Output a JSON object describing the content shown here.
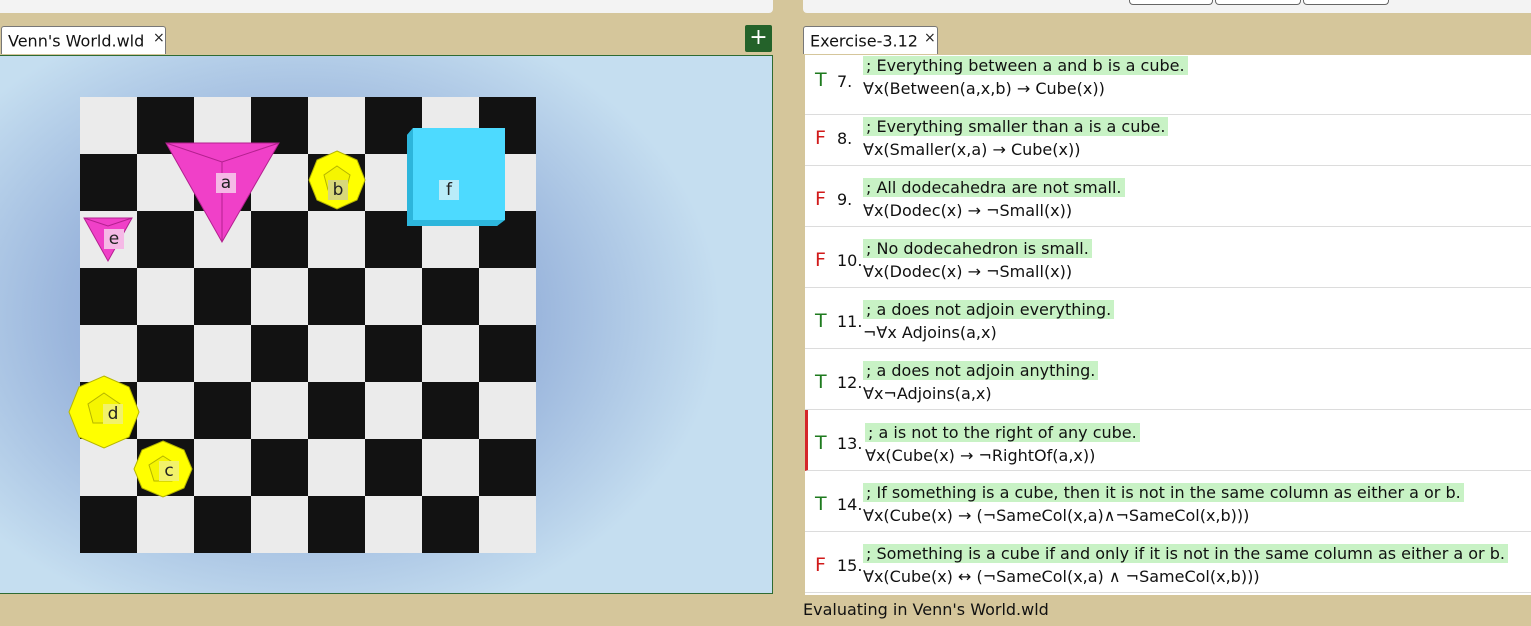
{
  "world_tab": {
    "label": "Venn's World.wld",
    "close": "×"
  },
  "add_tab_button": "+",
  "sentences_tab": {
    "label": "Exercise-3.12",
    "close": "×"
  },
  "pieces": [
    {
      "name": "a",
      "shape": "tetrahedron",
      "size": "large",
      "color": "#f040c8"
    },
    {
      "name": "b",
      "shape": "dodecahedron",
      "size": "small",
      "color": "#ffff00"
    },
    {
      "name": "c",
      "shape": "dodecahedron",
      "size": "medium",
      "color": "#ffff00"
    },
    {
      "name": "d",
      "shape": "dodecahedron",
      "size": "large",
      "color": "#ffff00"
    },
    {
      "name": "e",
      "shape": "tetrahedron",
      "size": "small",
      "color": "#f040c8"
    },
    {
      "name": "f",
      "shape": "cube",
      "size": "large",
      "color": "#4ddaff"
    }
  ],
  "sentences": [
    {
      "value": "T",
      "num": "7.",
      "comment": "; Everything between a and b is a cube.",
      "formula": "∀x(Between(a,x,b) → Cube(x))"
    },
    {
      "value": "F",
      "num": "8.",
      "comment": "; Everything smaller than a is a cube.",
      "formula": "∀x(Smaller(x,a) → Cube(x))"
    },
    {
      "value": "F",
      "num": "9.",
      "comment": "; All dodecahedra are not small.",
      "formula": "∀x(Dodec(x) → ¬Small(x))"
    },
    {
      "value": "F",
      "num": "10.",
      "comment": "; No dodecahedron is small.",
      "formula": "∀x(Dodec(x) → ¬Small(x))"
    },
    {
      "value": "T",
      "num": "11.",
      "comment": "; a does not adjoin everything.",
      "formula": "¬∀x Adjoins(a,x)"
    },
    {
      "value": "T",
      "num": "12.",
      "comment": "; a does not adjoin anything.",
      "formula": "∀x¬Adjoins(a,x)"
    },
    {
      "value": "T",
      "num": "13.",
      "comment": "; a is not to the right of any cube.",
      "formula": "∀x(Cube(x) → ¬RightOf(a,x))",
      "active": true
    },
    {
      "value": "T",
      "num": "14.",
      "comment": "; If something is a cube, then it is not in the same column as either a or b.",
      "formula": "∀x(Cube(x) → (¬SameCol(x,a)∧¬SameCol(x,b)))"
    },
    {
      "value": "F",
      "num": "15.",
      "comment": "; Something is a cube if and only if it is not in the same column as either a or b.",
      "formula": "∀x(Cube(x) ↔ (¬SameCol(x,a) ∧ ¬SameCol(x,b)))"
    }
  ],
  "status": "Evaluating in Venn's World.wld",
  "colors": {
    "true": "#1e7a1e",
    "false": "#d11a1a",
    "comment_bg": "#c8f2c5",
    "background": "#d5c69b",
    "active_marker": "#d5262a"
  }
}
